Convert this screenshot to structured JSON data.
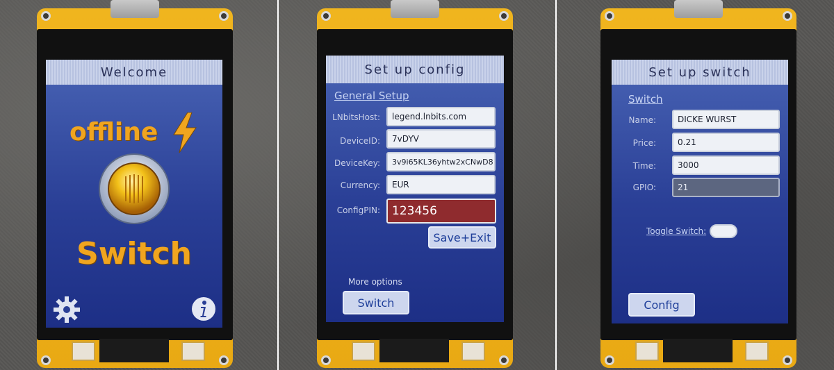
{
  "screens": [
    {
      "title": "Welcome",
      "status_text": "offline",
      "status_icon": "lightning-bolt-icon",
      "center_icon": "lamp-button-icon",
      "app_name": "Switch",
      "settings_icon": "gear-icon",
      "info_icon": "info-icon"
    },
    {
      "title": "Set up config",
      "section_link": "General Setup",
      "fields": [
        {
          "label": "LNbitsHost:",
          "value": "legend.lnbits.com"
        },
        {
          "label": "DeviceID:",
          "value": "7vDYV"
        },
        {
          "label": "DeviceKey:",
          "value": "3v9i65KL36yhtw2xCNwD8"
        },
        {
          "label": "Currency:",
          "value": "EUR"
        },
        {
          "label": "ConfigPIN:",
          "value": "123456"
        }
      ],
      "save_button": "Save+Exit",
      "more_options": "More options",
      "switch_button": "Switch"
    },
    {
      "title": "Set up switch",
      "section_link": "Switch",
      "fields": [
        {
          "label": "Name:",
          "value": "DICKE WURST"
        },
        {
          "label": "Price:",
          "value": "0.21"
        },
        {
          "label": "Time:",
          "value": "3000"
        },
        {
          "label": "GPIO:",
          "value": "21"
        }
      ],
      "toggle_label": "Toggle Switch:",
      "config_button": "Config"
    }
  ],
  "colors": {
    "accent_orange": "#f0a51f",
    "screen_blue": "#2a3f96",
    "pin_red": "#8f2b2e",
    "board_yellow": "#f0b51e"
  }
}
